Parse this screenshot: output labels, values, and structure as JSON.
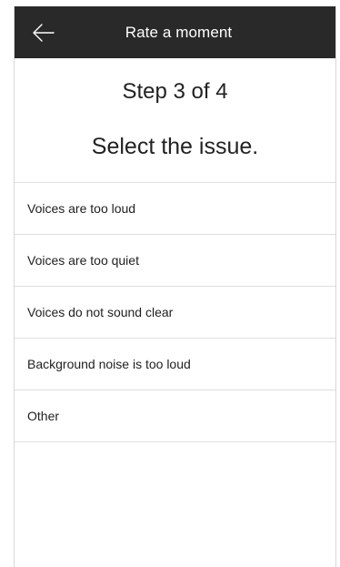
{
  "header": {
    "title": "Rate a moment",
    "back_icon": "arrow-left-icon"
  },
  "content": {
    "step_text": "Step 3 of 4",
    "prompt": "Select the issue."
  },
  "issues": [
    {
      "label": "Voices are too loud"
    },
    {
      "label": "Voices are too quiet"
    },
    {
      "label": "Voices do not sound clear"
    },
    {
      "label": "Background noise is too loud"
    },
    {
      "label": "Other"
    }
  ],
  "colors": {
    "header_bg": "#292929",
    "header_text": "#ffffff",
    "divider": "#dedede"
  }
}
